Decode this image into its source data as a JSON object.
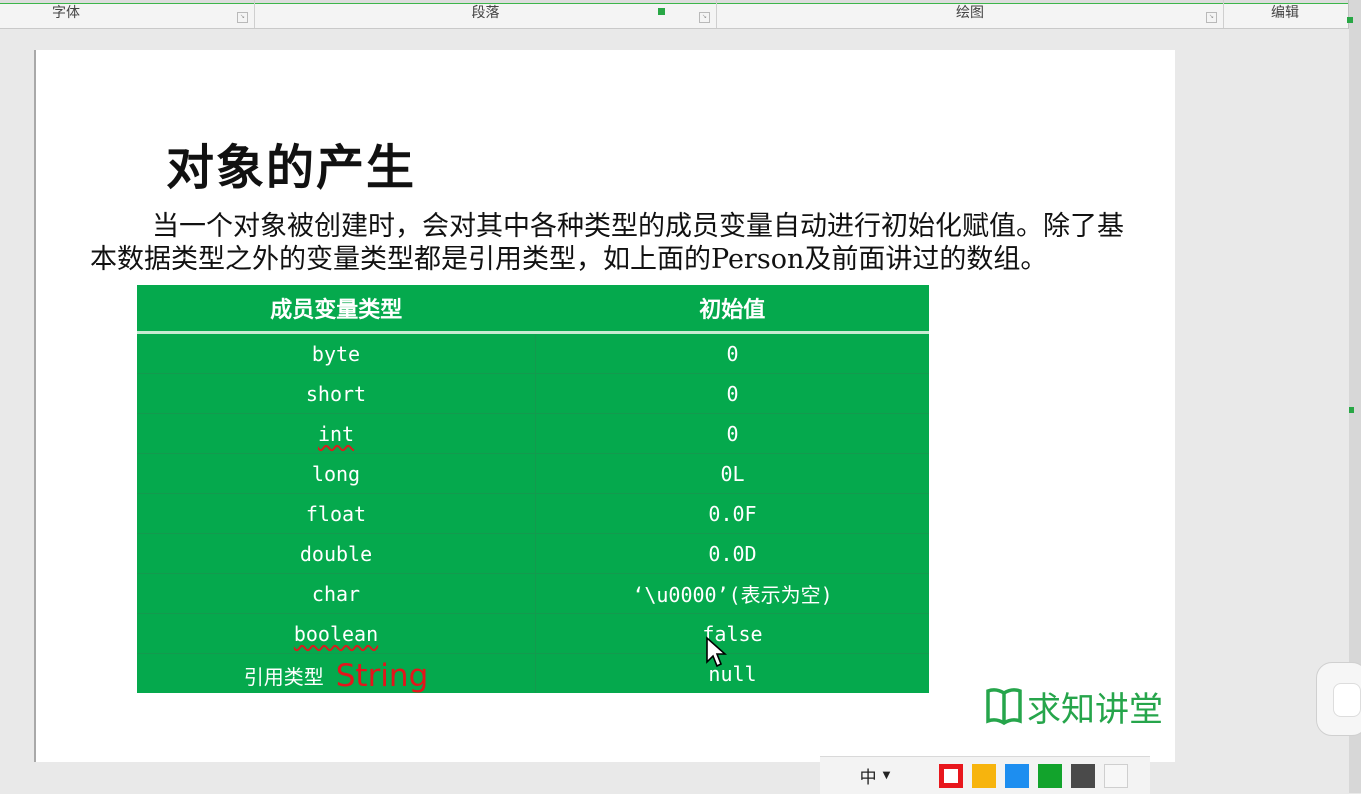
{
  "ribbon": {
    "groups": [
      {
        "label": "字体"
      },
      {
        "label": "段落"
      },
      {
        "label": "绘图"
      },
      {
        "label": "编辑"
      }
    ]
  },
  "slide": {
    "title": "对象的产生",
    "paragraph": "当一个对象被创建时，会对其中各种类型的成员变量自动进行初始化赋值。除了基本数据类型之外的变量类型都是引用类型，如上面的Person及前面讲过的数组。",
    "table": {
      "headers": [
        "成员变量类型",
        "初始值"
      ],
      "rows": [
        {
          "type": "byte",
          "value": "0"
        },
        {
          "type": "short",
          "value": "0"
        },
        {
          "type": "int",
          "value": "0"
        },
        {
          "type": "long",
          "value": "0L"
        },
        {
          "type": "float",
          "value": "0.0F"
        },
        {
          "type": "double",
          "value": "0.0D"
        },
        {
          "type": "char",
          "value": "‘\\u0000’(表示为空)"
        },
        {
          "type": "boolean",
          "value": "false"
        },
        {
          "type": "引用类型",
          "value": "null",
          "annotation": "String"
        }
      ]
    },
    "logo_text": "求知讲堂"
  },
  "palette": {
    "ime_label": "中",
    "swatches": [
      "#e8171d",
      "#f7b40d",
      "#1d8ef0",
      "#12a32c",
      "#4a4a4a",
      "#f7f7f7"
    ]
  },
  "colors": {
    "table_bg": "#05a94d",
    "logo": "#26a54b",
    "annotation": "#e5141b"
  }
}
